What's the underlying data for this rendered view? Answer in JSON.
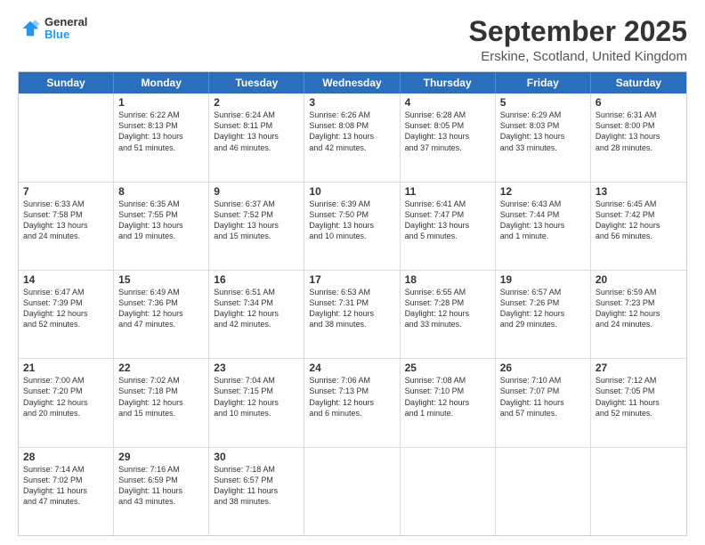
{
  "logo": {
    "general": "General",
    "blue": "Blue"
  },
  "header": {
    "month": "September 2025",
    "location": "Erskine, Scotland, United Kingdom"
  },
  "days": [
    "Sunday",
    "Monday",
    "Tuesday",
    "Wednesday",
    "Thursday",
    "Friday",
    "Saturday"
  ],
  "weeks": [
    [
      {
        "day": "",
        "info": ""
      },
      {
        "day": "1",
        "info": "Sunrise: 6:22 AM\nSunset: 8:13 PM\nDaylight: 13 hours\nand 51 minutes."
      },
      {
        "day": "2",
        "info": "Sunrise: 6:24 AM\nSunset: 8:11 PM\nDaylight: 13 hours\nand 46 minutes."
      },
      {
        "day": "3",
        "info": "Sunrise: 6:26 AM\nSunset: 8:08 PM\nDaylight: 13 hours\nand 42 minutes."
      },
      {
        "day": "4",
        "info": "Sunrise: 6:28 AM\nSunset: 8:05 PM\nDaylight: 13 hours\nand 37 minutes."
      },
      {
        "day": "5",
        "info": "Sunrise: 6:29 AM\nSunset: 8:03 PM\nDaylight: 13 hours\nand 33 minutes."
      },
      {
        "day": "6",
        "info": "Sunrise: 6:31 AM\nSunset: 8:00 PM\nDaylight: 13 hours\nand 28 minutes."
      }
    ],
    [
      {
        "day": "7",
        "info": "Sunrise: 6:33 AM\nSunset: 7:58 PM\nDaylight: 13 hours\nand 24 minutes."
      },
      {
        "day": "8",
        "info": "Sunrise: 6:35 AM\nSunset: 7:55 PM\nDaylight: 13 hours\nand 19 minutes."
      },
      {
        "day": "9",
        "info": "Sunrise: 6:37 AM\nSunset: 7:52 PM\nDaylight: 13 hours\nand 15 minutes."
      },
      {
        "day": "10",
        "info": "Sunrise: 6:39 AM\nSunset: 7:50 PM\nDaylight: 13 hours\nand 10 minutes."
      },
      {
        "day": "11",
        "info": "Sunrise: 6:41 AM\nSunset: 7:47 PM\nDaylight: 13 hours\nand 5 minutes."
      },
      {
        "day": "12",
        "info": "Sunrise: 6:43 AM\nSunset: 7:44 PM\nDaylight: 13 hours\nand 1 minute."
      },
      {
        "day": "13",
        "info": "Sunrise: 6:45 AM\nSunset: 7:42 PM\nDaylight: 12 hours\nand 56 minutes."
      }
    ],
    [
      {
        "day": "14",
        "info": "Sunrise: 6:47 AM\nSunset: 7:39 PM\nDaylight: 12 hours\nand 52 minutes."
      },
      {
        "day": "15",
        "info": "Sunrise: 6:49 AM\nSunset: 7:36 PM\nDaylight: 12 hours\nand 47 minutes."
      },
      {
        "day": "16",
        "info": "Sunrise: 6:51 AM\nSunset: 7:34 PM\nDaylight: 12 hours\nand 42 minutes."
      },
      {
        "day": "17",
        "info": "Sunrise: 6:53 AM\nSunset: 7:31 PM\nDaylight: 12 hours\nand 38 minutes."
      },
      {
        "day": "18",
        "info": "Sunrise: 6:55 AM\nSunset: 7:28 PM\nDaylight: 12 hours\nand 33 minutes."
      },
      {
        "day": "19",
        "info": "Sunrise: 6:57 AM\nSunset: 7:26 PM\nDaylight: 12 hours\nand 29 minutes."
      },
      {
        "day": "20",
        "info": "Sunrise: 6:59 AM\nSunset: 7:23 PM\nDaylight: 12 hours\nand 24 minutes."
      }
    ],
    [
      {
        "day": "21",
        "info": "Sunrise: 7:00 AM\nSunset: 7:20 PM\nDaylight: 12 hours\nand 20 minutes."
      },
      {
        "day": "22",
        "info": "Sunrise: 7:02 AM\nSunset: 7:18 PM\nDaylight: 12 hours\nand 15 minutes."
      },
      {
        "day": "23",
        "info": "Sunrise: 7:04 AM\nSunset: 7:15 PM\nDaylight: 12 hours\nand 10 minutes."
      },
      {
        "day": "24",
        "info": "Sunrise: 7:06 AM\nSunset: 7:13 PM\nDaylight: 12 hours\nand 6 minutes."
      },
      {
        "day": "25",
        "info": "Sunrise: 7:08 AM\nSunset: 7:10 PM\nDaylight: 12 hours\nand 1 minute."
      },
      {
        "day": "26",
        "info": "Sunrise: 7:10 AM\nSunset: 7:07 PM\nDaylight: 11 hours\nand 57 minutes."
      },
      {
        "day": "27",
        "info": "Sunrise: 7:12 AM\nSunset: 7:05 PM\nDaylight: 11 hours\nand 52 minutes."
      }
    ],
    [
      {
        "day": "28",
        "info": "Sunrise: 7:14 AM\nSunset: 7:02 PM\nDaylight: 11 hours\nand 47 minutes."
      },
      {
        "day": "29",
        "info": "Sunrise: 7:16 AM\nSunset: 6:59 PM\nDaylight: 11 hours\nand 43 minutes."
      },
      {
        "day": "30",
        "info": "Sunrise: 7:18 AM\nSunset: 6:57 PM\nDaylight: 11 hours\nand 38 minutes."
      },
      {
        "day": "",
        "info": ""
      },
      {
        "day": "",
        "info": ""
      },
      {
        "day": "",
        "info": ""
      },
      {
        "day": "",
        "info": ""
      }
    ]
  ]
}
